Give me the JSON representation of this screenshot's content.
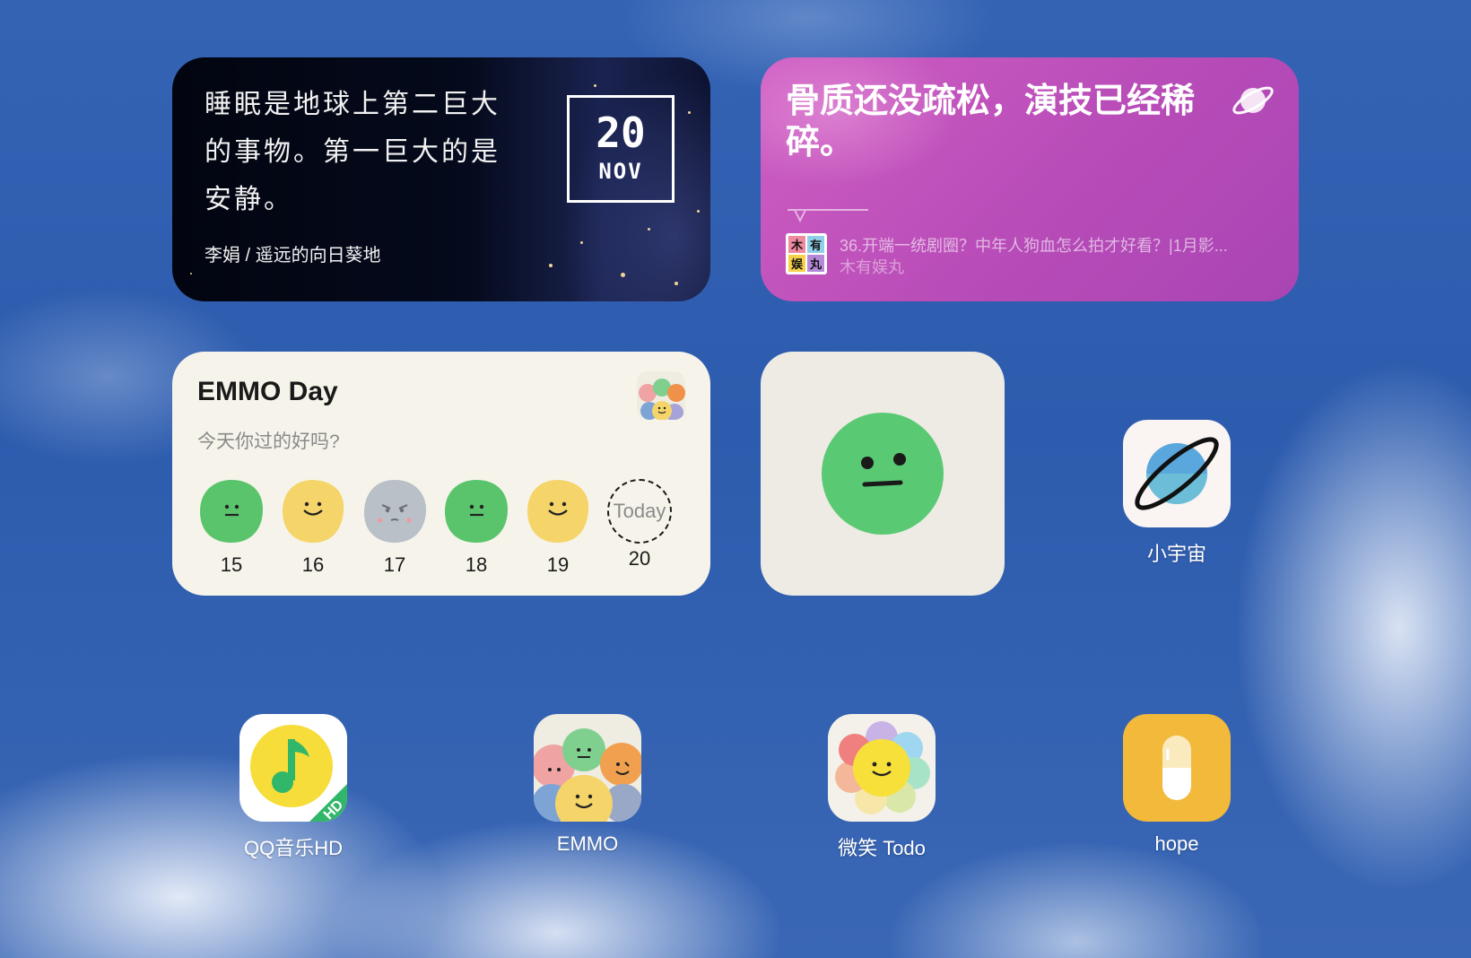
{
  "quote_widget": {
    "text": "睡眠是地球上第二巨大的事物。第一巨大的是安静。",
    "author": "李娟 / 遥远的向日葵地",
    "day": "20",
    "month": "NOV"
  },
  "podcast_widget": {
    "title": "骨质还没疏松，演技已经稀碎。",
    "episode": "36.开端一统剧圈？中年人狗血怎么拍才好看？|1月影...",
    "show": "木有娱丸",
    "cover_chars": [
      "木",
      "有",
      "娱",
      "丸"
    ],
    "accent": "#c056be"
  },
  "emmo_widget": {
    "title": "EMMO Day",
    "subtitle": "今天你过的好吗?",
    "today_label": "Today",
    "days": [
      {
        "label": "15",
        "mood": "neutral",
        "color": "#5ac46d"
      },
      {
        "label": "16",
        "mood": "happy",
        "color": "#f5d46a"
      },
      {
        "label": "17",
        "mood": "angry",
        "color": "#b9c0c8"
      },
      {
        "label": "18",
        "mood": "neutral",
        "color": "#5ac46d"
      },
      {
        "label": "19",
        "mood": "happy",
        "color": "#f5d46a"
      },
      {
        "label": "20",
        "mood": "today",
        "color": "#ffffff"
      }
    ]
  },
  "face_widget": {
    "mood": "neutral",
    "color": "#5ac974"
  },
  "apps": [
    {
      "label": "小宇宙",
      "icon": "planet-icon"
    },
    {
      "label": "QQ音乐HD",
      "icon": "music-note-icon"
    },
    {
      "label": "EMMO",
      "icon": "emmo-faces-icon"
    },
    {
      "label": "微笑 Todo",
      "icon": "smile-flower-icon"
    },
    {
      "label": "hope",
      "icon": "pill-icon"
    }
  ],
  "colors": {
    "wallpaper": "#3463b4",
    "qq_yellow": "#f7dd3a",
    "hope_yellow": "#f2b93a"
  }
}
